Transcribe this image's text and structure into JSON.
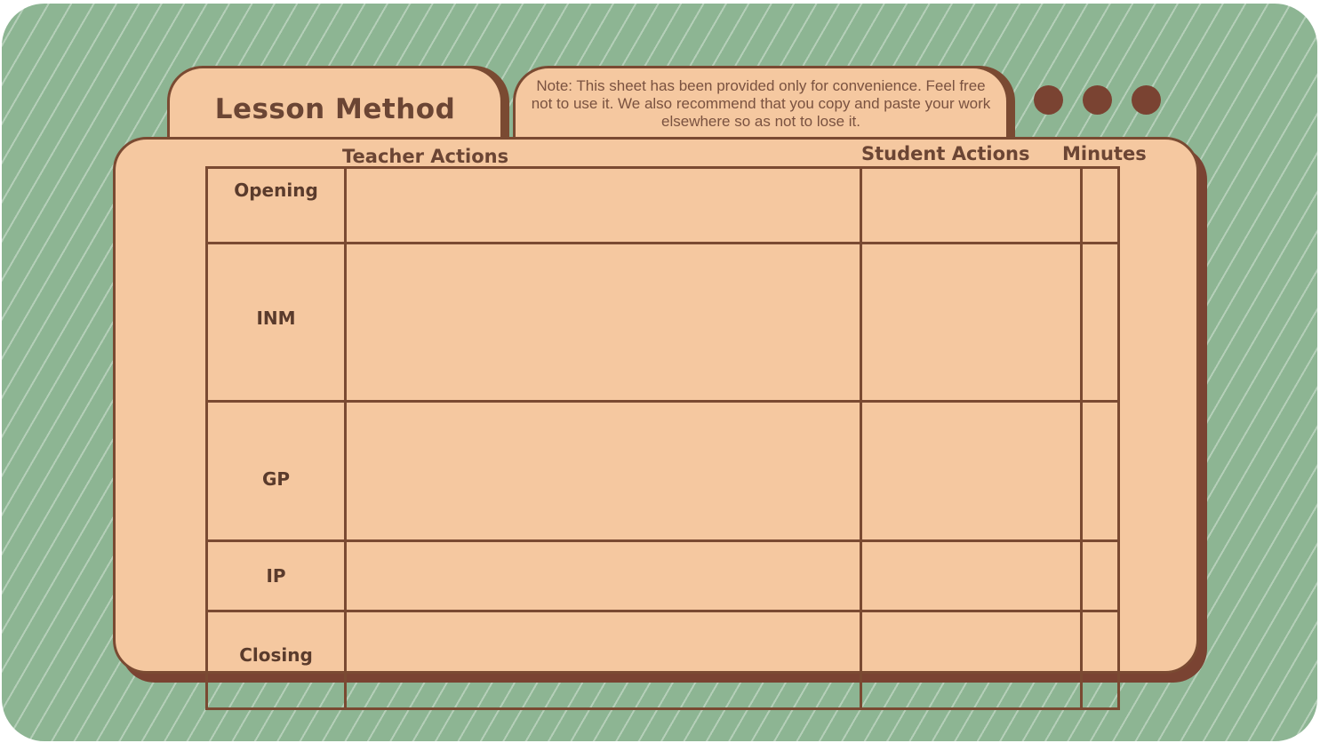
{
  "lesson": {
    "title": "Lesson Method",
    "note": "Note: This sheet has been provided only for convenience. Feel free not to use it. We also recommend that you copy and paste your work elsewhere so as not to lose it."
  },
  "colors": {
    "background": "#8db593",
    "card": "#f5c8a0",
    "border": "#7a4a32",
    "dots": "#7a4332",
    "text": "#6b4534"
  },
  "table": {
    "columns": [
      "Teacher Actions",
      "Student Actions",
      "Minutes"
    ],
    "rows": [
      {
        "label": "Opening",
        "teacher": "",
        "student": "",
        "minutes": ""
      },
      {
        "label": "INM",
        "teacher": "",
        "student": "",
        "minutes": ""
      },
      {
        "label": "GP",
        "teacher": "",
        "student": "",
        "minutes": ""
      },
      {
        "label": "IP",
        "teacher": "",
        "student": "",
        "minutes": ""
      },
      {
        "label": "Closing",
        "teacher": "",
        "student": "",
        "minutes": ""
      }
    ]
  }
}
